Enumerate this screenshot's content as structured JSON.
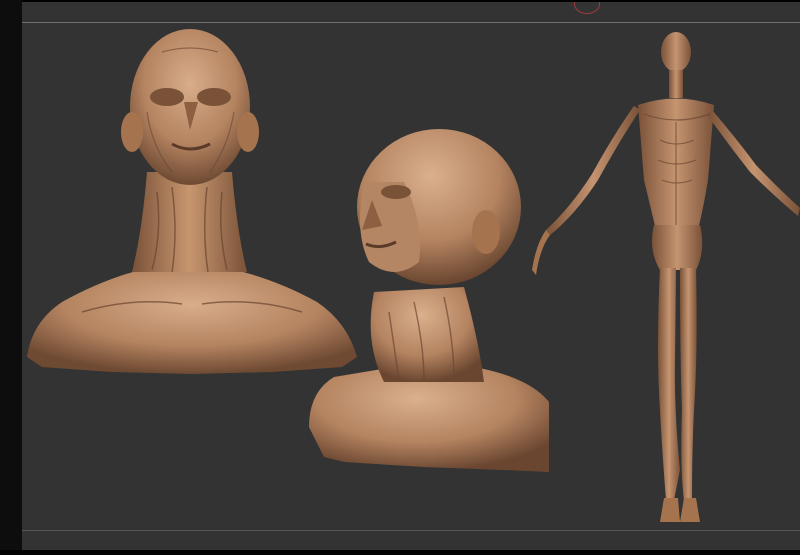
{
  "viewport": {
    "background": "#333333",
    "models": [
      {
        "name": "front-bust",
        "view": "front"
      },
      {
        "name": "three-quarter-bust",
        "view": "three-quarter"
      },
      {
        "name": "full-body",
        "view": "front"
      }
    ],
    "material_color": "#b48360",
    "material_highlight": "#d4a886",
    "material_shadow": "#6e4a33"
  }
}
